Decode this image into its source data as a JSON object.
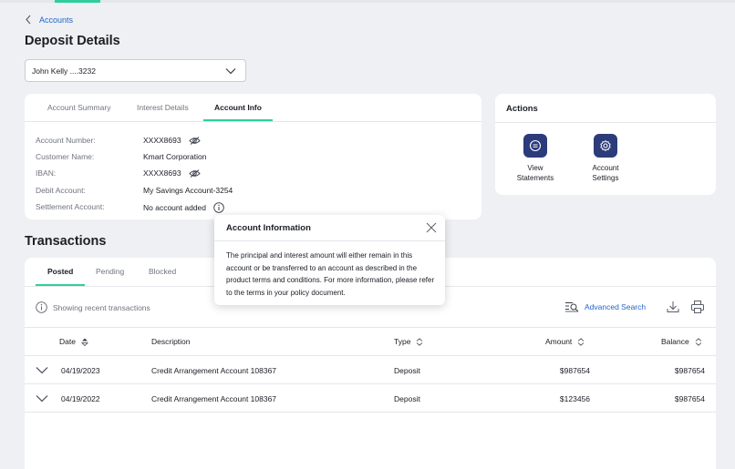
{
  "nav": {
    "back_label": "Accounts"
  },
  "page": {
    "title": "Deposit Details"
  },
  "account_selector": {
    "selected": "John Kelly ....3232"
  },
  "info_tabs": [
    "Account Summary",
    "Interest Details",
    "Account Info"
  ],
  "account_info": {
    "account_number": {
      "label": "Account Number:",
      "value": "XXXX8693"
    },
    "customer_name": {
      "label": "Customer Name:",
      "value": "Kmart Corporation"
    },
    "iban": {
      "label": "IBAN:",
      "value": "XXXX8693"
    },
    "debit_account": {
      "label": "Debit Account:",
      "value": "My Savings Account-3254"
    },
    "settlement_account": {
      "label": "Settlement Account:",
      "value": "No account added"
    }
  },
  "actions": {
    "title": "Actions",
    "items": [
      {
        "label_line1": "View",
        "label_line2": "Statements",
        "icon": "statements-icon"
      },
      {
        "label_line1": "Account",
        "label_line2": "Settings",
        "icon": "gear-icon"
      }
    ]
  },
  "tooltip": {
    "title": "Account Information",
    "body": "The principal and interest amount will either remain in this account or be transferred to an account as described in the product terms and conditions. For more information, please refer to the terms in your policy document."
  },
  "transactions": {
    "title": "Transactions",
    "tabs": [
      "Posted",
      "Pending",
      "Blocked"
    ],
    "showing_text": "Showing recent transactions",
    "advanced_search": "Advanced Search",
    "columns": {
      "date": "Date",
      "description": "Description",
      "type": "Type",
      "amount": "Amount",
      "balance": "Balance"
    },
    "rows": [
      {
        "date": "04/19/2023",
        "description": "Credit Arrangement Account 108367",
        "type": "Deposit",
        "amount": "$987654",
        "balance": "$987654"
      },
      {
        "date": "04/19/2022",
        "description": "Credit Arrangement Account 108367",
        "type": "Deposit",
        "amount": "$123456",
        "balance": "$987654"
      }
    ]
  },
  "colors": {
    "accent": "#2ecf9a",
    "link": "#2466c7",
    "action_icon_bg": "#2c3b7a"
  }
}
